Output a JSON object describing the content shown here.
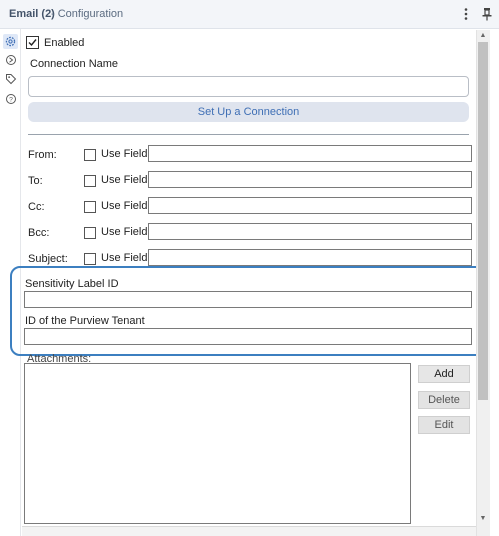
{
  "window": {
    "title": "Email (2)",
    "subtitle": "- Configuration",
    "menu_icon": "more-vertical-icon",
    "pin_icon": "pin-icon"
  },
  "rail": {
    "items": [
      {
        "icon": "gear-icon",
        "active": true
      },
      {
        "icon": "arrow-circle-icon",
        "active": false
      },
      {
        "icon": "tag-icon",
        "active": false
      },
      {
        "icon": "help-circle-icon",
        "active": false
      }
    ]
  },
  "form": {
    "enabled_label": "Enabled",
    "enabled_checked": true,
    "connection_name_label": "Connection Name",
    "connection_name_value": "",
    "setup_button": "Set Up a Connection",
    "rows": [
      {
        "label": "From:",
        "use_field_label": "Use Field",
        "checked": false,
        "value": ""
      },
      {
        "label": "To:",
        "use_field_label": "Use Field",
        "checked": false,
        "value": ""
      },
      {
        "label": "Cc:",
        "use_field_label": "Use Field",
        "checked": false,
        "value": ""
      },
      {
        "label": "Bcc:",
        "use_field_label": "Use Field",
        "checked": false,
        "value": ""
      },
      {
        "label": "Subject:",
        "use_field_label": "Use Field",
        "checked": false,
        "value": ""
      }
    ],
    "sensitivity_label": "Sensitivity Label ID",
    "sensitivity_value": "",
    "tenant_label": "ID of the Purview Tenant",
    "tenant_value": "",
    "attachments_label": "Attachments:",
    "add_button": "Add",
    "delete_button": "Delete",
    "edit_button": "Edit"
  },
  "colors": {
    "highlight": "#3c7fc0",
    "accent_text": "#3f6fb5"
  }
}
